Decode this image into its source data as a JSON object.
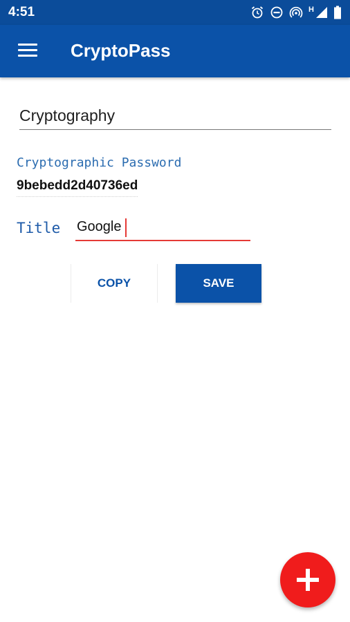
{
  "status_bar": {
    "time": "4:51",
    "network_label": "H",
    "icons": [
      "alarm-icon",
      "do-not-disturb-icon",
      "hotspot-icon",
      "signal-icon",
      "battery-icon"
    ]
  },
  "app_bar": {
    "title": "CryptoPass",
    "menu_icon": "menu-icon"
  },
  "form": {
    "domain_value": "Cryptography",
    "password_label": "Cryptographic Password",
    "password_value": "9bebedd2d40736ed",
    "title_label": "Title",
    "title_value": "Google"
  },
  "buttons": {
    "copy": "COPY",
    "save": "SAVE"
  },
  "fab": {
    "icon": "plus-icon"
  },
  "colors": {
    "primary": "#0b52a8",
    "status_bar": "#0b4c9a",
    "accent": "#f01c1c",
    "label_blue": "#2b6cb0"
  }
}
